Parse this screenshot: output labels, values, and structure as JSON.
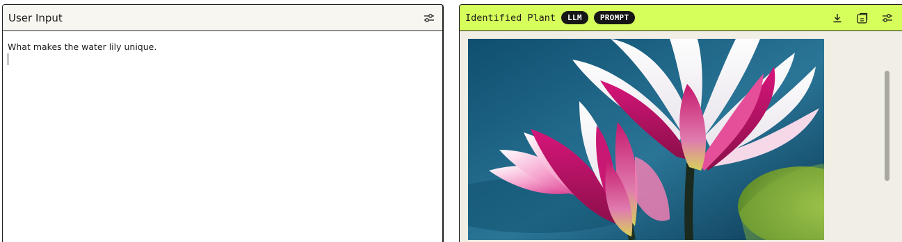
{
  "left_panel": {
    "title": "User Input",
    "input_value": "What makes the water lily unique.",
    "settings_icon": "sliders-icon"
  },
  "right_panel": {
    "title": "Identified Plant",
    "badges": [
      "LLM",
      "PROMPT"
    ],
    "icons": [
      "download-icon",
      "copy-icon",
      "sliders-icon"
    ],
    "header_color": "#d6ff5c"
  }
}
